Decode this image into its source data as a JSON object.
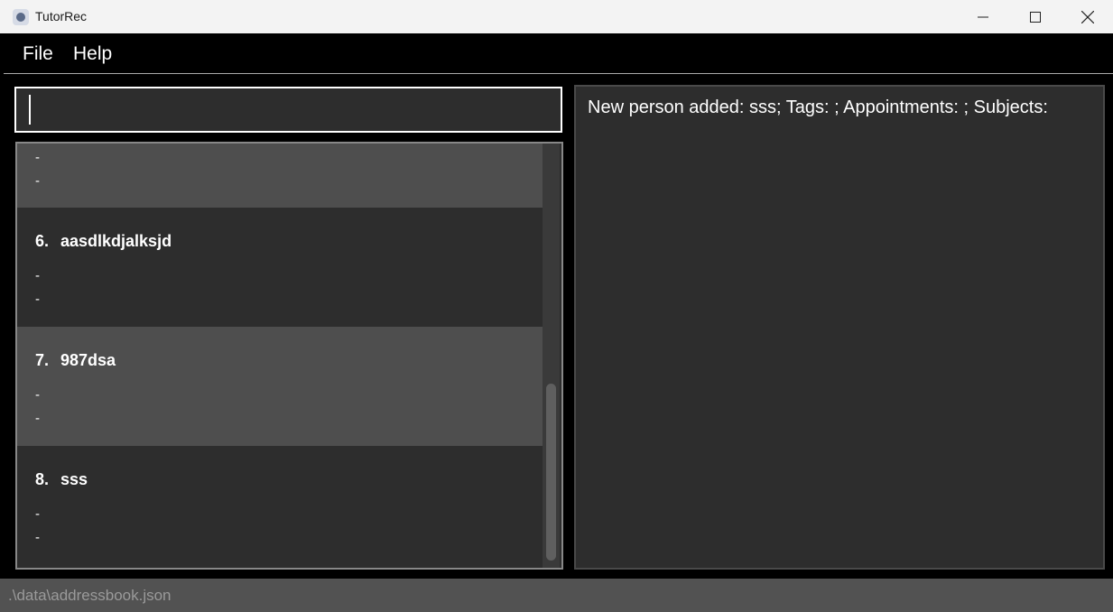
{
  "window": {
    "title": "TutorRec"
  },
  "menu": {
    "file": "File",
    "help": "Help"
  },
  "command_box": {
    "value": ""
  },
  "person_list": {
    "partial_card": {
      "dash1": "-",
      "dash2": "-"
    },
    "cards": [
      {
        "index": "6.",
        "name": "aasdlkdjalksjd",
        "line1": "-",
        "line2": "-"
      },
      {
        "index": "7.",
        "name": "987dsa",
        "line1": "-",
        "line2": "-"
      },
      {
        "index": "8.",
        "name": "sss",
        "line1": "-",
        "line2": "-"
      }
    ]
  },
  "result_display": {
    "text": "New person added: sss; Tags: ; Appointments: ; Subjects:"
  },
  "status_bar": {
    "path": ".\\data\\addressbook.json"
  }
}
